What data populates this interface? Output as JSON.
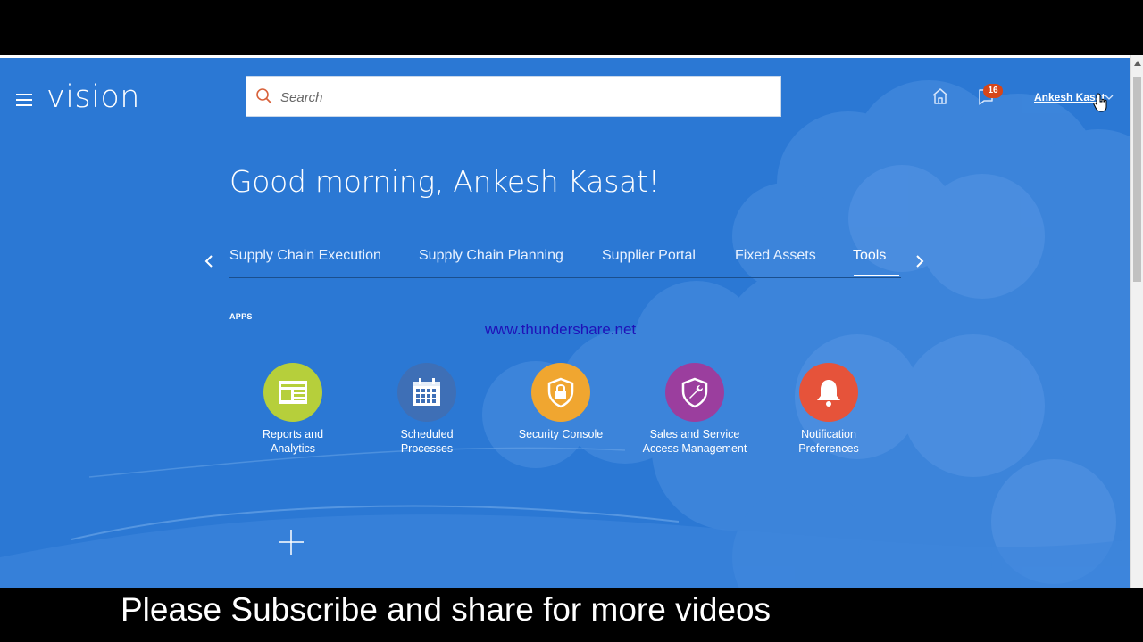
{
  "header": {
    "logo": "vision",
    "search_placeholder": "Search",
    "notification_count": "16",
    "user_name": "Ankesh Kasat"
  },
  "greeting": "Good morning, Ankesh Kasat!",
  "tabs": [
    {
      "label": "Supply Chain Execution",
      "active": false
    },
    {
      "label": "Supply Chain Planning",
      "active": false
    },
    {
      "label": "Supplier Portal",
      "active": false
    },
    {
      "label": "Fixed Assets",
      "active": false
    },
    {
      "label": "Tools",
      "active": true
    }
  ],
  "apps_section": {
    "label": "APPS",
    "items": [
      {
        "label": "Reports and Analytics",
        "icon": "reports-icon",
        "color": "#b6cf3b"
      },
      {
        "label": "Scheduled Processes",
        "icon": "calendar-icon",
        "color": "#3e6fb6"
      },
      {
        "label": "Security Console",
        "icon": "lock-shield-icon",
        "color": "#f0a630"
      },
      {
        "label": "Sales and Service Access Management",
        "icon": "wrench-shield-icon",
        "color": "#9b3e9e"
      },
      {
        "label": "Notification Preferences",
        "icon": "bell-icon",
        "color": "#e6533a"
      }
    ]
  },
  "watermark": "www.thundershare.net",
  "caption": "Please Subscribe and share for more videos",
  "colors": {
    "background": "#2b78d4",
    "badge": "#d6461a"
  }
}
